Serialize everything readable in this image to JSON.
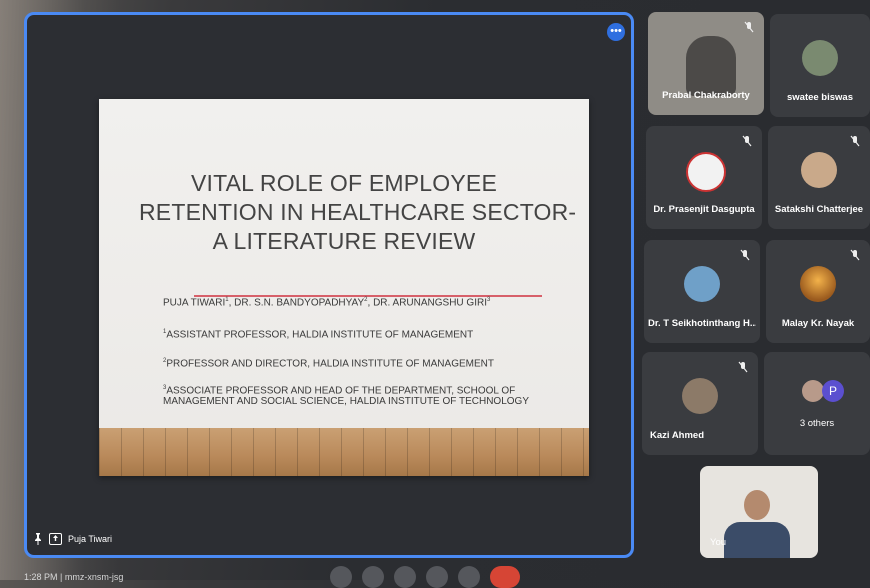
{
  "stage": {
    "menu_glyph": "•••",
    "presenter_name": "Puja Tiwari"
  },
  "slide": {
    "title_lines": [
      "VITAL ROLE OF EMPLOYEE",
      "RETENTION IN HEALTHCARE SECTOR-",
      "A LITERATURE REVIEW"
    ],
    "authors": {
      "a1": "PUJA TIWARI",
      "s1": "1",
      "a2": ", DR. S.N. BANDYOPADHYAY",
      "s2": "2",
      "a3": ", DR. ARUNANGSHU GIRI",
      "s3": "3"
    },
    "affiliations": [
      {
        "sup": "1",
        "text": "ASSISTANT PROFESSOR, HALDIA INSTITUTE OF MANAGEMENT"
      },
      {
        "sup": "2",
        "text": "PROFESSOR AND DIRECTOR, HALDIA INSTITUTE OF MANAGEMENT"
      },
      {
        "sup": "3",
        "text": "ASSOCIATE PROFESSOR AND HEAD OF THE DEPARTMENT, SCHOOL OF",
        "cont": "MANAGEMENT AND SOCIAL SCIENCE, HALDIA INSTITUTE OF TECHNOLOGY"
      }
    ]
  },
  "participants": [
    {
      "name": "Prabal Chakraborty"
    },
    {
      "name": "swatee biswas"
    },
    {
      "name": "Dr. Prasenjit Dasgupta"
    },
    {
      "name": "Satakshi Chatterjee"
    },
    {
      "name": "Dr. T Seikhotinthang H..."
    },
    {
      "name": "Malay Kr. Nayak"
    },
    {
      "name": "Kazi Ahmed"
    },
    {
      "name": "3 others"
    }
  ],
  "self_tile": {
    "label": "You"
  },
  "others_avatar_letter": "P",
  "clock": "1:28 PM",
  "meeting_code": "mmz-xnsm-jsg",
  "colors": {
    "accent": "#4a8af4",
    "tile_bg": "#3a3c40",
    "end_call": "#d64535"
  }
}
